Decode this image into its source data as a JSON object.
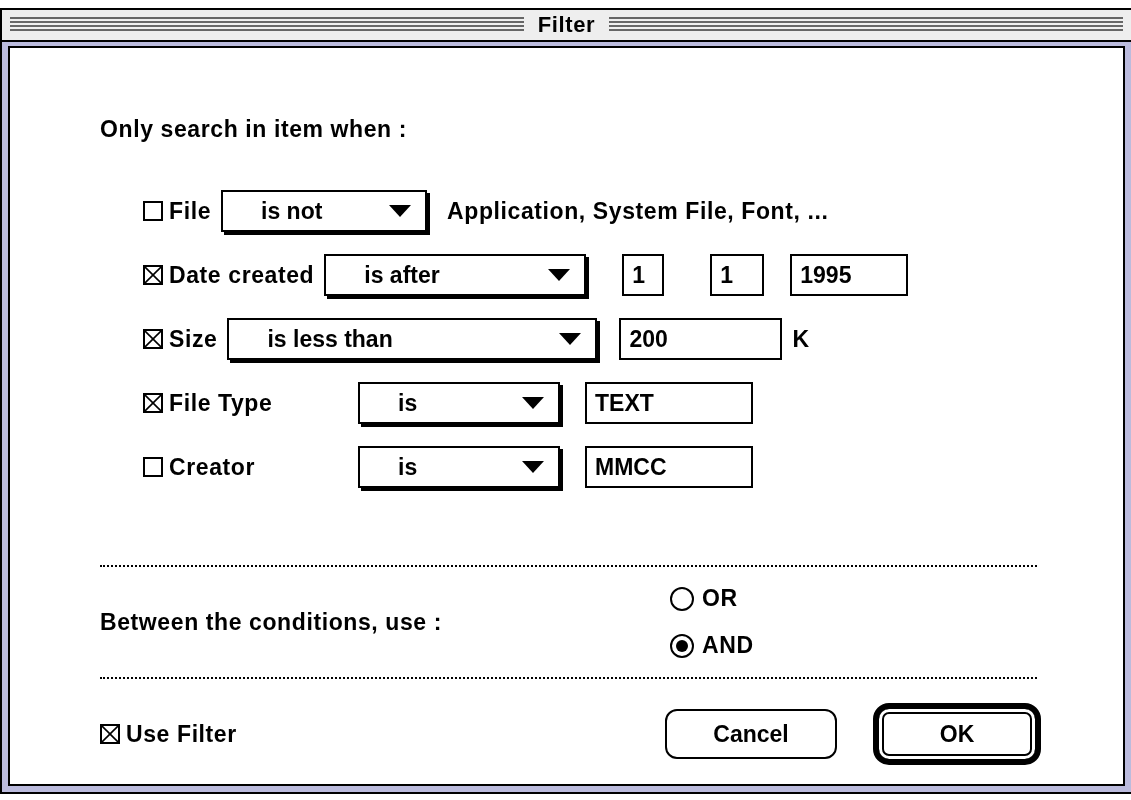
{
  "window": {
    "title": "Filter"
  },
  "heading": "Only search in item when :",
  "conditions": [
    {
      "checked": false,
      "label": "File",
      "operator": "is not",
      "text": "Application, System File, Font, ..."
    },
    {
      "checked": true,
      "label": "Date created",
      "operator": "is after",
      "fields": [
        "1",
        "1",
        "1995"
      ]
    },
    {
      "checked": true,
      "label": "Size",
      "operator": "is less than",
      "fields": [
        "200"
      ],
      "unit": "K"
    },
    {
      "checked": true,
      "label": "File Type",
      "operator": "is",
      "fields": [
        "TEXT"
      ]
    },
    {
      "checked": false,
      "label": "Creator",
      "operator": "is",
      "fields": [
        "MMCC"
      ]
    }
  ],
  "combine": {
    "label": "Between the conditions, use :",
    "options": [
      {
        "label": "OR",
        "selected": false
      },
      {
        "label": "AND",
        "selected": true
      }
    ]
  },
  "use_filter": {
    "label": "Use Filter",
    "checked": true
  },
  "buttons": [
    {
      "label": "Cancel",
      "default": false
    },
    {
      "label": "OK",
      "default": true
    }
  ]
}
